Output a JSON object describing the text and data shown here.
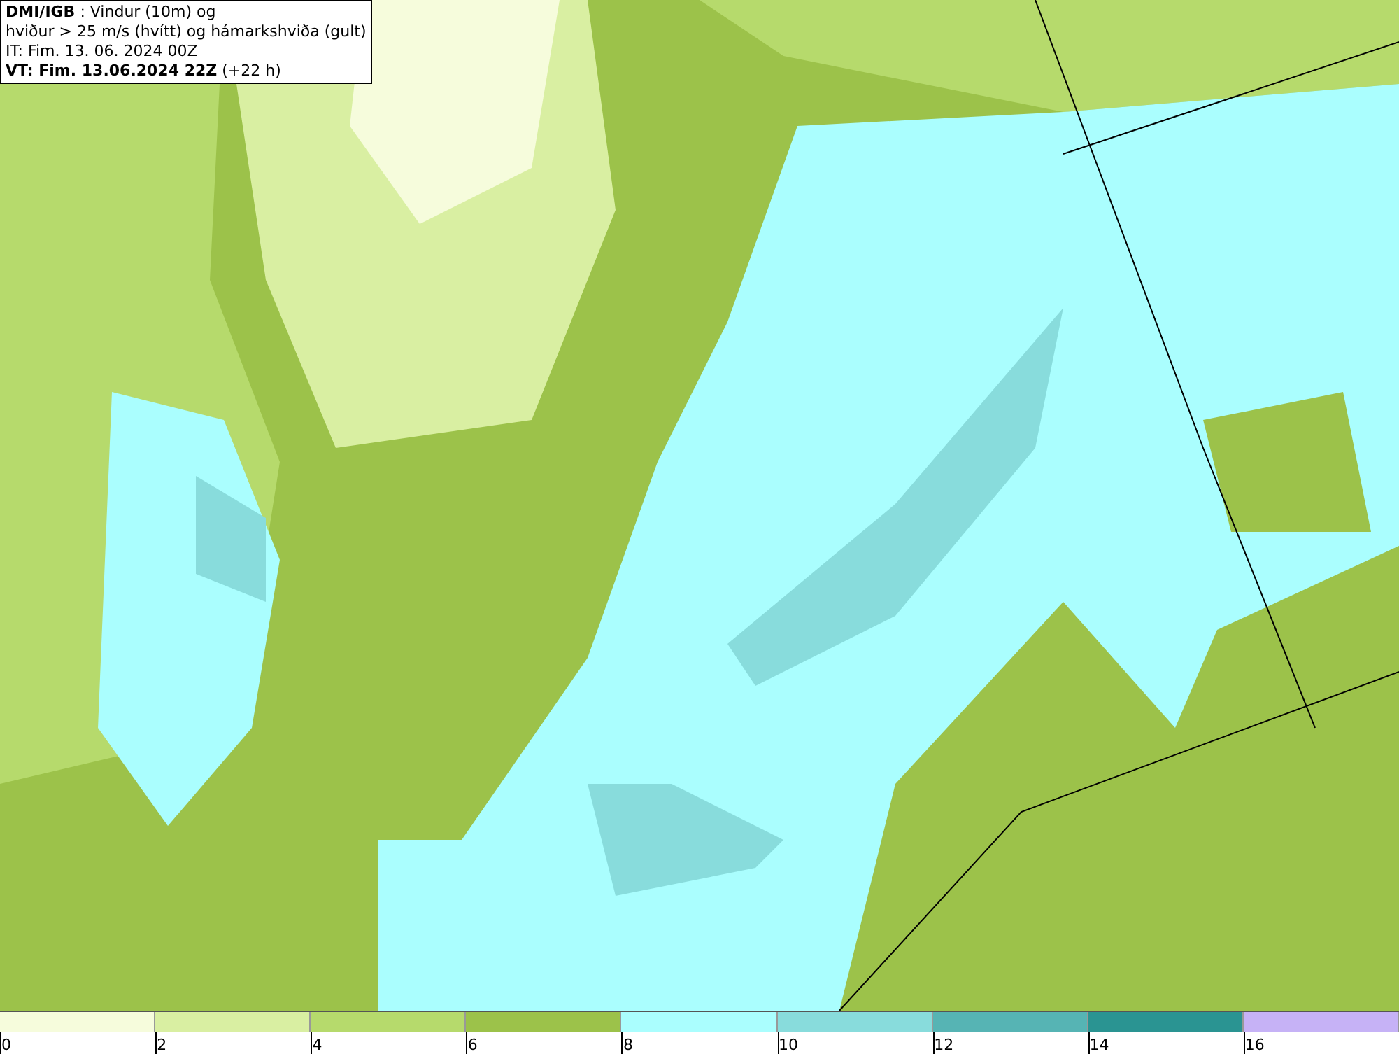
{
  "info_box": {
    "lines": [
      "**DMI/IGB** : Vindur (10m) og",
      "hviður > 25 m/s (hvítt) og hámarkshviða (gult)",
      "IT: Fim. 13. 06. 2024 00Z",
      "**VT: Fim. 13.06.2024 22Z** (+22 h)"
    ]
  },
  "legend": [
    {
      "label": "0",
      "color": "#f6fcdc"
    },
    {
      "label": "2",
      "color": "#d9efa2"
    },
    {
      "label": "4",
      "color": "#b6da6c"
    },
    {
      "label": "6",
      "color": "#9cc24a"
    },
    {
      "label": "8",
      "color": "#aafefe"
    },
    {
      "label": "10",
      "color": "#88dcdc"
    },
    {
      "label": "12",
      "color": "#56b4b4"
    },
    {
      "label": "14",
      "color": "#2a9492"
    },
    {
      "label": "16",
      "color": "#c6b2f6"
    }
  ]
}
